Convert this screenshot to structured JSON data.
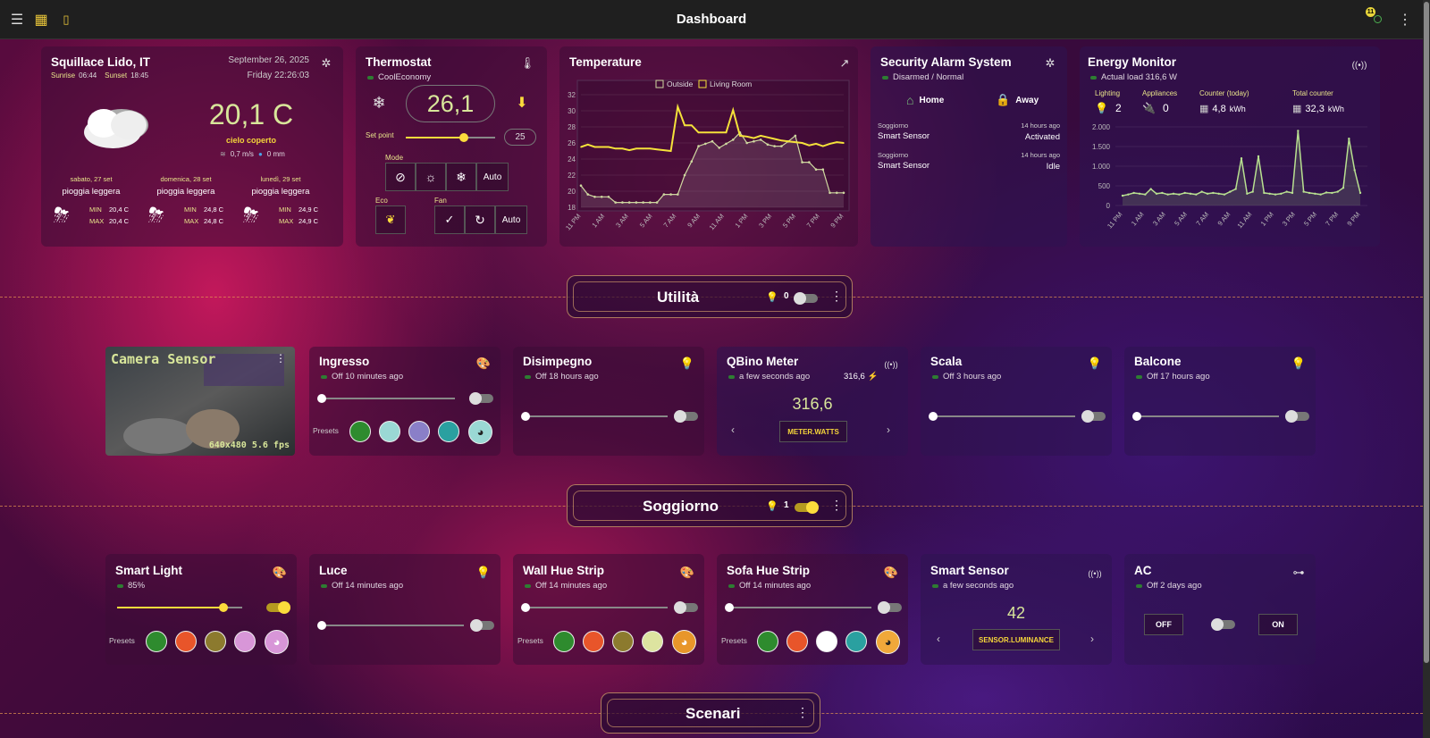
{
  "topbar": {
    "title": "Dashboard",
    "badge": "11"
  },
  "weather": {
    "location": "Squillace Lido, IT",
    "date": "September 26, 2025",
    "time": "Friday 22:26:03",
    "sunrise_label": "Sunrise",
    "sunrise": "06:44",
    "sunset_label": "Sunset",
    "sunset": "18:45",
    "temp": "20,1 C",
    "condition": "cielo coperto",
    "wind": "0,7 m/s",
    "rain": "0 mm",
    "forecast": [
      {
        "day": "sabato, 27 set",
        "cond": "pioggia leggera",
        "min_label": "MIN",
        "min": "20,4 C",
        "max_label": "MAX",
        "max": "20,4 C"
      },
      {
        "day": "domenica, 28 set",
        "cond": "pioggia leggera",
        "min_label": "MIN",
        "min": "24,8 C",
        "max_label": "MAX",
        "max": "24,8 C"
      },
      {
        "day": "lunedì, 29 set",
        "cond": "pioggia leggera",
        "min_label": "MIN",
        "min": "24,9 C",
        "max_label": "MAX",
        "max": "24,9 C"
      }
    ]
  },
  "thermostat": {
    "title": "Thermostat",
    "status": "CoolEconomy",
    "current": "26,1",
    "setpoint_label": "Set point",
    "setpoint": "25",
    "setpoint_level": 0.65,
    "mode_label": "Mode",
    "mode_auto": "Auto",
    "eco_label": "Eco",
    "fan_label": "Fan",
    "fan_auto": "Auto"
  },
  "chart_data": {
    "type": "line",
    "title": "Temperature",
    "series": [
      {
        "name": "Outside",
        "values": [
          20.7,
          19.6,
          19.3,
          19.3,
          19.3,
          18.6,
          18.6,
          18.6,
          18.6,
          18.6,
          18.6,
          18.6,
          19.6,
          19.6,
          19.6,
          22,
          23.7,
          25.6,
          25.9,
          26.2,
          25.4,
          25.9,
          26.4,
          27.3,
          26,
          26.2,
          26.4,
          25.8,
          25.6,
          25.6,
          26.2,
          26.9,
          23.6,
          23.6,
          22.7,
          22.7,
          19.8,
          19.8,
          19.8
        ]
      },
      {
        "name": "Living Room",
        "values": [
          25.5,
          25.8,
          25.5,
          25.5,
          25.5,
          25.3,
          25.3,
          25.1,
          25.3,
          25.3,
          25.3,
          25.2,
          25.1,
          25.0,
          30.5,
          28.2,
          28.2,
          27.3,
          27.3,
          27.3,
          27.3,
          27.3,
          30.1,
          26.9,
          26.8,
          26.6,
          26.9,
          26.7,
          26.5,
          26.3,
          26.2,
          26.1,
          26.0,
          25.7,
          25.9,
          25.6,
          25.9,
          26.1,
          26.0
        ]
      }
    ],
    "categories": [
      "11 PM",
      "",
      "1 AM",
      "",
      "3 AM",
      "",
      "5 AM",
      "",
      "7 AM",
      "",
      "9 AM",
      "",
      "11 AM",
      "",
      "1 PM",
      "",
      "3 PM",
      "",
      "5 PM",
      "",
      "7 PM",
      "",
      "9 PM"
    ],
    "ylim": [
      18,
      32
    ],
    "yticks": [
      "32",
      "30",
      "28",
      "26",
      "24",
      "22",
      "20",
      "18"
    ],
    "legend": "top-center"
  },
  "alarm": {
    "title": "Security Alarm System",
    "status": "Disarmed / Normal",
    "home": "Home",
    "away": "Away",
    "events": [
      {
        "room": "Soggiorno",
        "time": "14 hours ago",
        "sensor": "Smart Sensor",
        "state": "Activated"
      },
      {
        "room": "Soggiorno",
        "time": "14 hours ago",
        "sensor": "Smart Sensor",
        "state": "Idle"
      }
    ]
  },
  "energy": {
    "title": "Energy Monitor",
    "status": "Actual load 316,6 W",
    "lighting_label": "Lighting",
    "lighting": "2",
    "appliances_label": "Appliances",
    "appliances": "0",
    "counter_label": "Counter (today)",
    "counter": "4,8",
    "counter_unit": "kWh",
    "total_label": "Total counter",
    "total": "32,3",
    "total_unit": "kWh",
    "yticks": [
      "2.000",
      "1.500",
      "1.000",
      "500",
      "0"
    ],
    "xticks": [
      "11 PM",
      "1 AM",
      "3 AM",
      "5 AM",
      "7 AM",
      "9 AM",
      "11 AM",
      "1 PM",
      "3 PM",
      "5 PM",
      "7 PM",
      "9 PM"
    ],
    "values": [
      250,
      280,
      320,
      300,
      280,
      420,
      300,
      320,
      280,
      300,
      280,
      320,
      300,
      280,
      350,
      300,
      320,
      300,
      280,
      350,
      420,
      1200,
      300,
      350,
      1250,
      320,
      300,
      280,
      300,
      350,
      320,
      1900,
      350,
      320,
      300,
      280,
      330,
      320,
      350,
      450,
      1700,
      900,
      320
    ]
  },
  "utilita": {
    "title": "Utilità",
    "count": "0"
  },
  "soggiorno": {
    "title": "Soggiorno",
    "count": "1"
  },
  "scenari": {
    "title": "Scenari"
  },
  "camera": {
    "title": "Camera Sensor",
    "res": "640x480 5.6 fps"
  },
  "ingresso": {
    "title": "Ingresso",
    "status": "Off 10 minutes ago",
    "presets_label": "Presets",
    "presets": [
      "#2e8b2e",
      "#9ad8d4",
      "#8a7fc8",
      "#2aa0a0"
    ]
  },
  "disimpegno": {
    "title": "Disimpegno",
    "status": "Off 18 hours ago"
  },
  "qbino": {
    "title": "QBino Meter",
    "status": "a few seconds ago",
    "side": "316,6",
    "value": "316,6",
    "entity": "METER.WATTS"
  },
  "scala": {
    "title": "Scala",
    "status": "Off 3 hours ago"
  },
  "balcone": {
    "title": "Balcone",
    "status": "Off 17 hours ago"
  },
  "smartlight": {
    "title": "Smart Light",
    "status": "85%",
    "level": 0.85,
    "presets_label": "Presets",
    "presets": [
      "#2e8b2e",
      "#e8552a",
      "#8c7a2e",
      "#d896d8"
    ]
  },
  "luce": {
    "title": "Luce",
    "status": "Off 14 minutes ago"
  },
  "wallhue": {
    "title": "Wall Hue Strip",
    "status": "Off 14 minutes ago",
    "presets_label": "Presets",
    "presets": [
      "#2e8b2e",
      "#e8552a",
      "#8c7a2e",
      "#dde4a0"
    ]
  },
  "sofahue": {
    "title": "Sofa Hue Strip",
    "status": "Off 14 minutes ago",
    "presets_label": "Presets",
    "presets": [
      "#2e8b2e",
      "#e8552a",
      "#ffffff",
      "#2aa0a0"
    ]
  },
  "smartsensor": {
    "title": "Smart Sensor",
    "status": "a few seconds ago",
    "value": "42",
    "entity": "SENSOR.LUMINANCE"
  },
  "ac": {
    "title": "AC",
    "status": "Off 2 days ago",
    "off": "OFF",
    "on": "ON"
  }
}
